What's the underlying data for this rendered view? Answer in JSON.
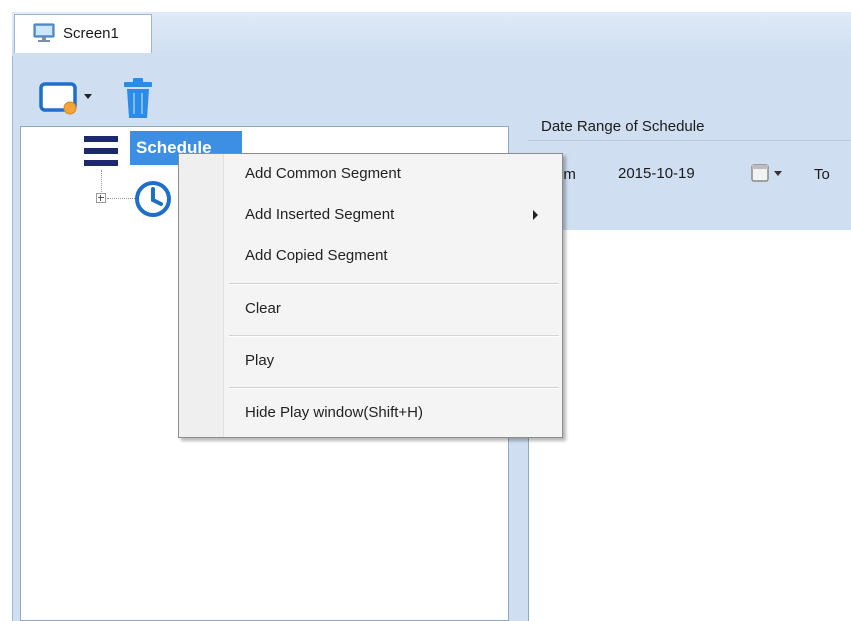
{
  "tab": {
    "label": "Screen1",
    "icon": "monitor-icon"
  },
  "toolbar": {
    "items": [
      {
        "name": "add-screen-dropdown",
        "icon": "window-add-icon"
      },
      {
        "name": "delete",
        "icon": "trash-icon"
      }
    ]
  },
  "tree": {
    "root": {
      "label": "Schedule",
      "icon": "list-lines-icon"
    },
    "child": {
      "icon": "clock-icon"
    }
  },
  "schedule_settings": {
    "date_range_title": "Date Range of Schedule",
    "from_label": "om",
    "from_date": "2015-10-19",
    "to_label": "To"
  },
  "context_menu": {
    "items": [
      {
        "label": "Add Common Segment",
        "has_submenu": false
      },
      {
        "label": "Add Inserted Segment",
        "has_submenu": true
      },
      {
        "label": "Add Copied Segment",
        "has_submenu": false
      },
      {
        "label": "Clear",
        "has_submenu": false
      },
      {
        "label": "Play",
        "has_submenu": false
      },
      {
        "label": "Hide Play window(Shift+H)",
        "has_submenu": false
      }
    ]
  },
  "colors": {
    "selection": "#3d8fe3",
    "pane_bg": "#cfdff1",
    "icon_blue": "#1f6fc9",
    "navy": "#1d2a6a"
  }
}
